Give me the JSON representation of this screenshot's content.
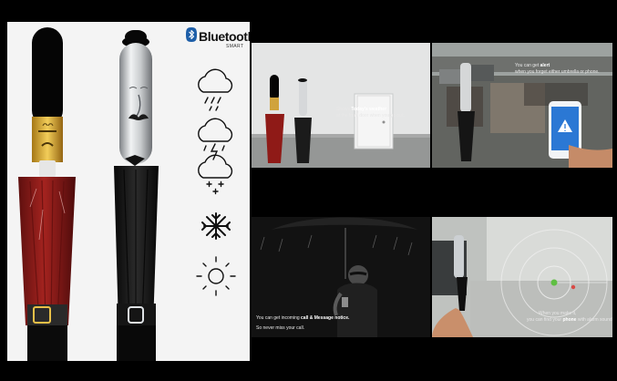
{
  "brand": {
    "logo_word": "Bluetooth",
    "logo_subtitle": "SMART"
  },
  "weather_icons": [
    "rain-cloud-icon",
    "thunder-cloud-icon",
    "snow-cloud-icon",
    "snowflake-icon",
    "sun-icon"
  ],
  "captions": {
    "panel1": {
      "line1_prefix": "Shows ",
      "line1_bold": "Today's weather",
      "line2": "at the front door when you go out."
    },
    "panel2": {
      "line1_prefix": "You can get ",
      "line1_bold": "alert",
      "line2": "when you forget either umbrella or phone."
    },
    "panel3": {
      "line1_prefix": "You can get incoming ",
      "line1_bold": "call & Message notice.",
      "line2": "So never miss your call."
    },
    "panel4": {
      "line1": "When you make it,",
      "line2_prefix": "you can find your ",
      "line2_bold": "phone",
      "line2_suffix": " with alarm sound"
    }
  },
  "colors": {
    "red_umbrella": "#8e1b18",
    "black_umbrella": "#1a1a1a",
    "gold": "#d6a62e",
    "silver": "#bfc3c6",
    "alert_blue": "#2b78d4"
  }
}
